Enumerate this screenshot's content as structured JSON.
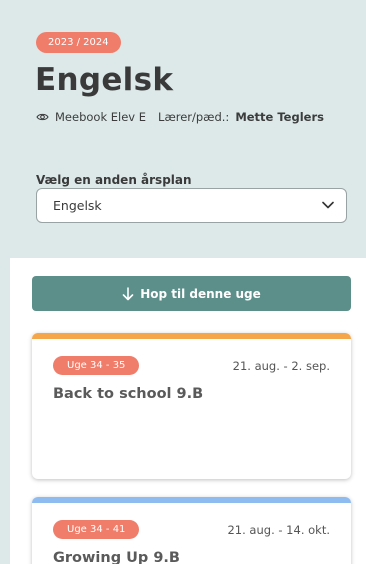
{
  "header": {
    "year": "2023 / 2024",
    "title": "Engelsk",
    "viewer": "Meebook Elev E",
    "teacher_label": "Lærer/pæd.:",
    "teacher_name": "Mette Teglers",
    "select_label": "Vælg en anden årsplan",
    "select_value": "Engelsk"
  },
  "actions": {
    "jump_label": "Hop til denne uge"
  },
  "cards": [
    {
      "week": "Uge 34 - 35",
      "dates": "21. aug. - 2. sep.",
      "title": "Back to school 9.B",
      "accent": "#f5a54a"
    },
    {
      "week": "Uge 34 - 41",
      "dates": "21. aug. - 14. okt.",
      "title": "Growing Up 9.B",
      "accent": "#8fbcf0"
    }
  ],
  "colors": {
    "header_bg": "#dde9e9",
    "badge": "#f07c6a",
    "primary_button": "#5c8f8a"
  },
  "icons": {
    "viewer": "eye-icon",
    "select": "chevron-down-icon",
    "jump": "arrow-down-icon"
  }
}
